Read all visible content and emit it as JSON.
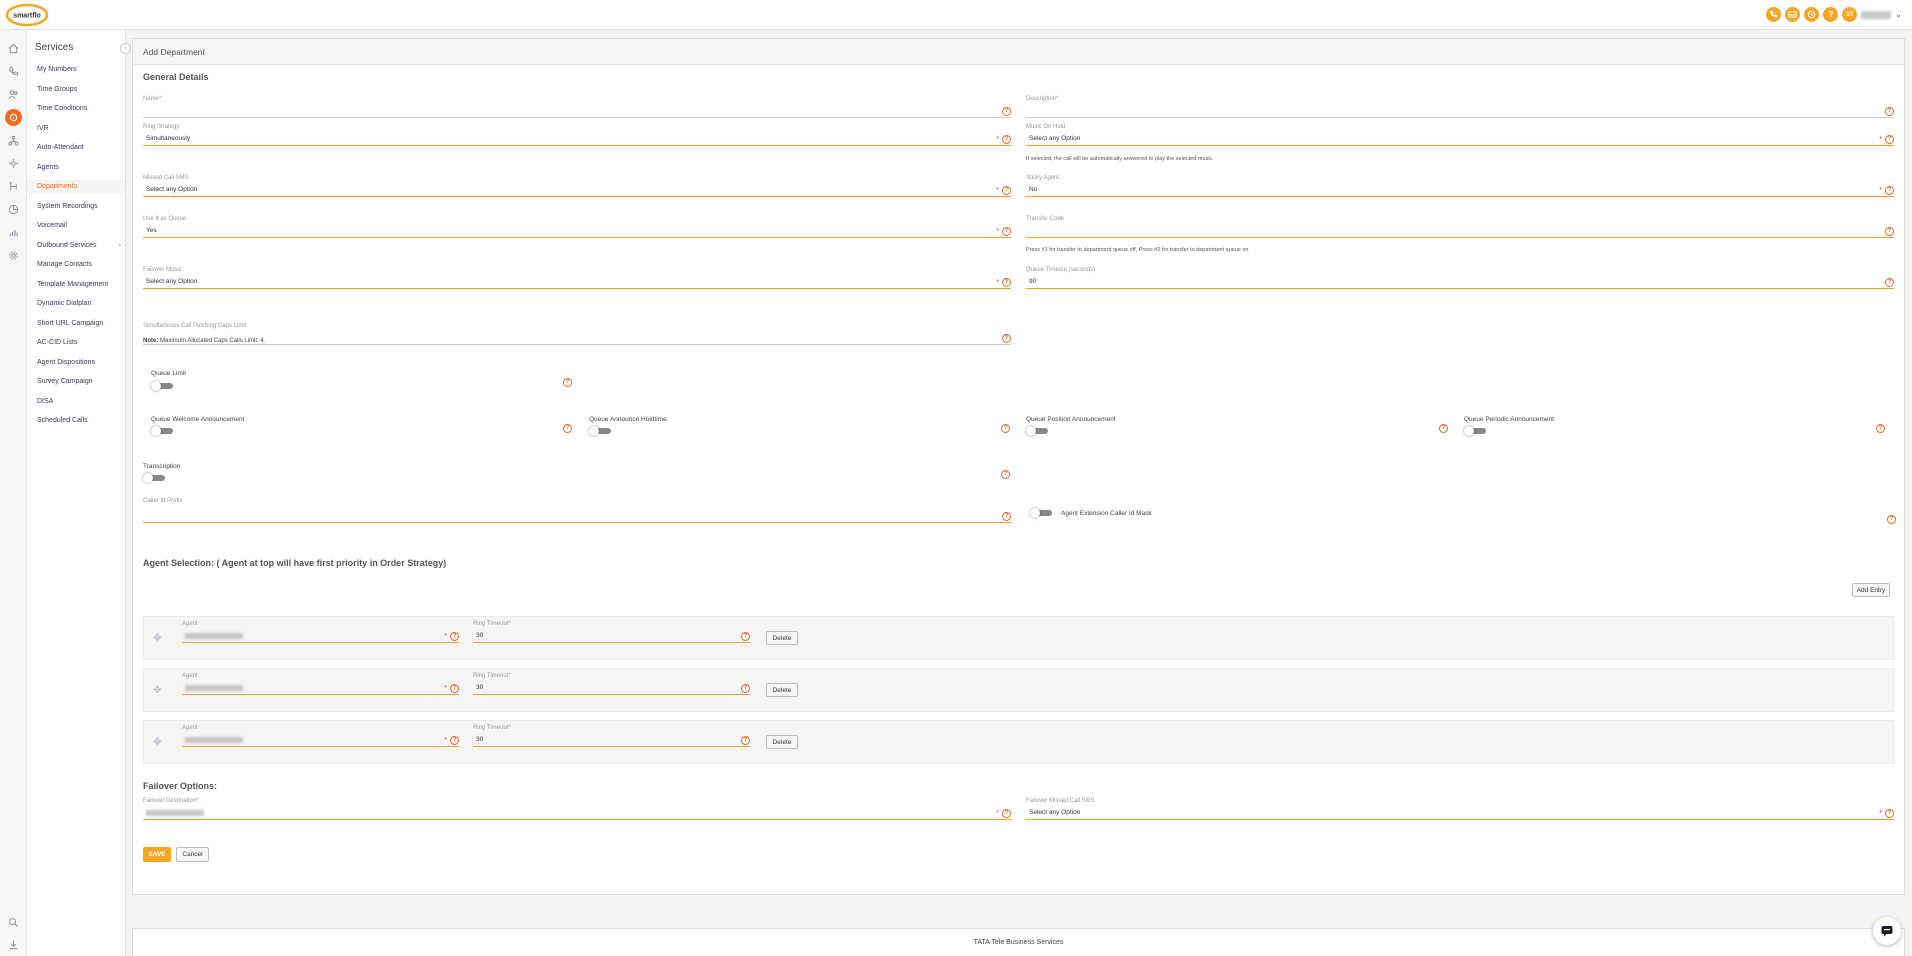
{
  "brand": {
    "logo_text": "smartflo",
    "accent": "#f26b21",
    "secondary": "#f5a623"
  },
  "topbar": {
    "icons": [
      "phone-icon",
      "inbox-icon",
      "call-log-icon",
      "help-icon"
    ],
    "help_glyph": "?",
    "user_initials": "ST",
    "user_caret": "⌄"
  },
  "sidebar": {
    "title": "Services",
    "collapse_glyph": "‹",
    "items": [
      {
        "label": "My Numbers"
      },
      {
        "label": "Time Groups"
      },
      {
        "label": "Time Conditions"
      },
      {
        "label": "IVR"
      },
      {
        "label": "Auto-Attendant"
      },
      {
        "label": "Agents"
      },
      {
        "label": "Departments",
        "active": true
      },
      {
        "label": "System Recordings"
      },
      {
        "label": "Voicemail"
      },
      {
        "label": "Outbound Services",
        "chevron": "›"
      },
      {
        "label": "Manage Contacts"
      },
      {
        "label": "Template Management"
      },
      {
        "label": "Dynamic Dialplan"
      },
      {
        "label": "Short URL Campaign"
      },
      {
        "label": "AC-CID Lists"
      },
      {
        "label": "Agent Dispositions"
      },
      {
        "label": "Survey Campaign"
      },
      {
        "label": "DISA"
      },
      {
        "label": "Scheduled Calls"
      }
    ]
  },
  "page": {
    "title": "Add Department",
    "general_details": "General Details",
    "help_glyph": "?",
    "required_mark": "*",
    "fields": {
      "name": {
        "label": "Name*",
        "value": ""
      },
      "description": {
        "label": "Description*",
        "value": ""
      },
      "ring_strategy": {
        "label": "Ring Strategy",
        "value": "Simultaneously"
      },
      "music_on_hold": {
        "label": "Music On Hold",
        "value": "Select any Option",
        "hint": "If selected, the call will be automatically answered to play the selected music."
      },
      "missed_call_sms": {
        "label": "Missed Call SMS",
        "value": "Select any Option"
      },
      "sticky_agent": {
        "label": "Sticky Agent",
        "value": "No"
      },
      "use_as_queue": {
        "label": "Use It as Queue",
        "value": "Yes"
      },
      "transfer_code": {
        "label": "Transfer Code",
        "value": "",
        "hint": "Press #1 for transfer to department queue off, Press #2 for transfer to department queue on"
      },
      "failover_music": {
        "label": "Failover Music",
        "value": "Select any Option"
      },
      "queue_timeout": {
        "label": "Queue Timeout (seconds)",
        "value": "90"
      },
      "sim_call_limit": {
        "label": "Simultaneous Call Patching Caps Limit",
        "value": ""
      },
      "caller_id_prefix": {
        "label": "Caller Id Prefix",
        "value": ""
      }
    },
    "note": {
      "bold": "Note:",
      "text": " Maximum Allocated Caps Calls Limit: 4."
    },
    "toggles": {
      "queue_limit": "Queue Limit",
      "queue_welcome": "Queue Welcome Announcement",
      "queue_holdtime": "Queue Announce Holdtime",
      "queue_position": "Queue Position Announcement",
      "queue_periodic": "Queue Periodic Announcement",
      "transcription": "Transcription",
      "agent_ext_mask": "Agent Extension Caller Id Mask"
    },
    "agent_selection": {
      "title": "Agent Selection: ( Agent at top will have first priority in Order Strategy)",
      "add_entry": "Add Entry",
      "agent_label": "Agent",
      "ring_timeout_label": "Ring Timeout*",
      "delete_label": "Delete",
      "rows": [
        {
          "ring_timeout": "30"
        },
        {
          "ring_timeout": "30"
        },
        {
          "ring_timeout": "30"
        }
      ]
    },
    "failover": {
      "title": "Failover Options:",
      "destination_label": "Failover Destination*",
      "missed_sms_label": "Failover Missed Call SMS",
      "missed_sms_value": "Select any Option"
    },
    "buttons": {
      "save": "SAVE",
      "cancel": "Cancel"
    }
  },
  "footer": {
    "text": "TATA Tele Business Services"
  }
}
